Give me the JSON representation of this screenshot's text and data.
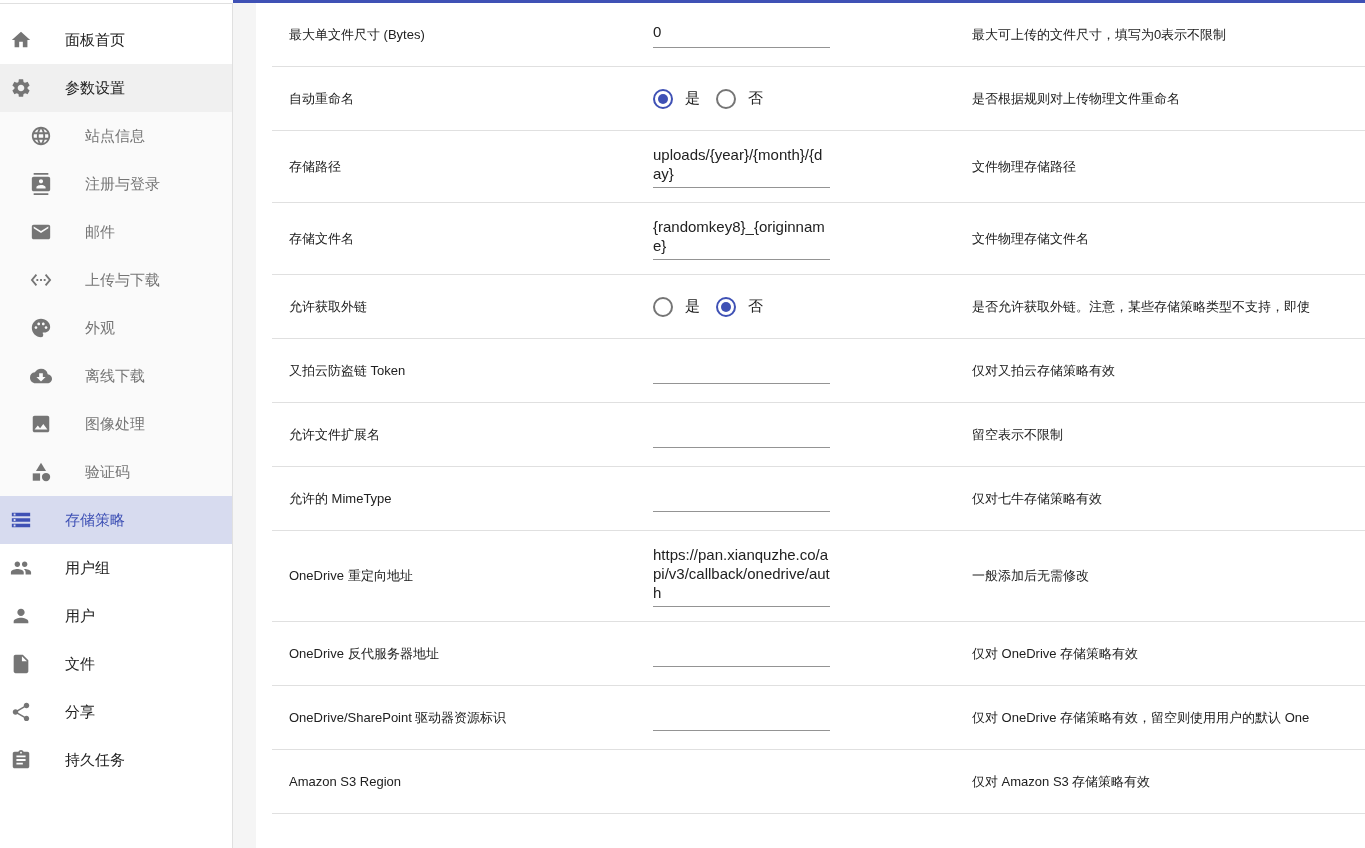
{
  "sidebar": {
    "items": [
      {
        "label": "面板首页",
        "selected": false
      },
      {
        "label": "参数设置",
        "selected": false,
        "expanded": true,
        "children": [
          {
            "label": "站点信息",
            "selected": false
          },
          {
            "label": "注册与登录",
            "selected": false
          },
          {
            "label": "邮件",
            "selected": false
          },
          {
            "label": "上传与下载",
            "selected": false
          },
          {
            "label": "外观",
            "selected": false
          },
          {
            "label": "离线下载",
            "selected": false
          },
          {
            "label": "图像处理",
            "selected": false
          },
          {
            "label": "验证码",
            "selected": false
          }
        ]
      },
      {
        "label": "存储策略",
        "selected": true
      },
      {
        "label": "用户组",
        "selected": false
      },
      {
        "label": "用户",
        "selected": false
      },
      {
        "label": "文件",
        "selected": false
      },
      {
        "label": "分享",
        "selected": false
      },
      {
        "label": "持久任务",
        "selected": false
      }
    ]
  },
  "settings": [
    {
      "kind": "text",
      "label": "最大单文件尺寸 (Bytes)",
      "value": "0",
      "description": "最大可上传的文件尺寸，填写为0表示不限制"
    },
    {
      "kind": "radio",
      "label": "自动重命名",
      "options": [
        {
          "label": "是",
          "selected": true
        },
        {
          "label": "否",
          "selected": false
        }
      ],
      "description": "是否根据规则对上传物理文件重命名"
    },
    {
      "kind": "text",
      "label": "存储路径",
      "value": "uploads/{year}/{month}/{day}",
      "description": "文件物理存储路径"
    },
    {
      "kind": "text",
      "label": "存储文件名",
      "value": "{randomkey8}_{originname}",
      "description": "文件物理存储文件名"
    },
    {
      "kind": "radio",
      "label": "允许获取外链",
      "options": [
        {
          "label": "是",
          "selected": false
        },
        {
          "label": "否",
          "selected": true
        }
      ],
      "description": "是否允许获取外链。注意，某些存储策略类型不支持，即使"
    },
    {
      "kind": "text",
      "label": "又拍云防盗链 Token",
      "description": "仅对又拍云存储策略有效"
    },
    {
      "kind": "text",
      "label": "允许文件扩展名",
      "description": "留空表示不限制"
    },
    {
      "kind": "text",
      "label": "允许的 MimeType",
      "description": "仅对七牛存储策略有效"
    },
    {
      "kind": "text",
      "label": "OneDrive 重定向地址",
      "value": "https://pan.xianquzhe.co/api/v3/callback/onedrive/auth",
      "description": "一般添加后无需修改"
    },
    {
      "kind": "text",
      "label": "OneDrive 反代服务器地址",
      "description": "仅对 OneDrive 存储策略有效"
    },
    {
      "kind": "text",
      "label": "OneDrive/SharePoint 驱动器资源标识",
      "description": "仅对 OneDrive 存储策略有效，留空则使用用户的默认 One"
    },
    {
      "kind": "none",
      "label": "Amazon S3 Region",
      "description": "仅对 Amazon S3 存储策略有效"
    }
  ]
}
